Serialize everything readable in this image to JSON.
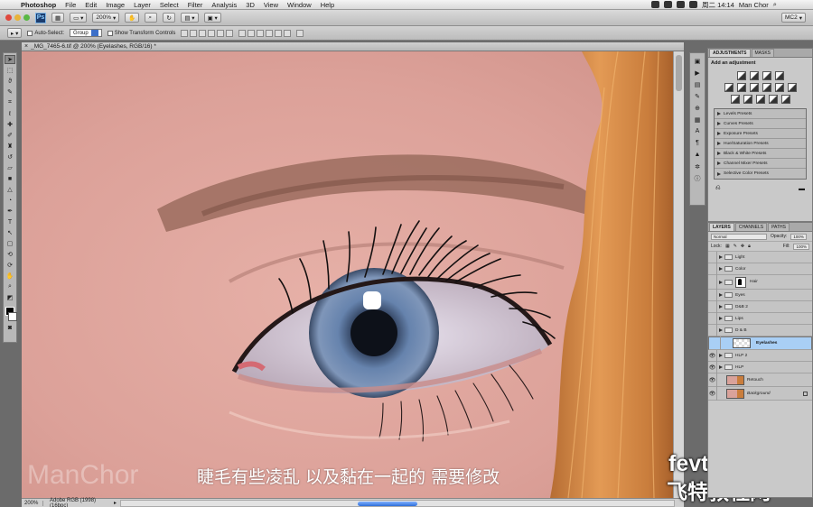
{
  "menubar": {
    "apple": "",
    "items": [
      "Photoshop",
      "File",
      "Edit",
      "Image",
      "Layer",
      "Select",
      "Filter",
      "Analysis",
      "3D",
      "View",
      "Window",
      "Help"
    ],
    "clock": "周二 14:14",
    "user": "Man Chor"
  },
  "appbar": {
    "ps_logo": "Ps",
    "zoom": "200%",
    "workspace": "MC2"
  },
  "options": {
    "auto_select_label": "Auto-Select:",
    "auto_select_value": "Group",
    "transform_label": "Show Transform Controls"
  },
  "document": {
    "tab_title": "_MG_7465-6.tif @ 200% (Eyelashes, RGB/16) *",
    "status_zoom": "200%",
    "status_info": "Adobe RGB (1998) (16bpc)"
  },
  "overlay": {
    "subtitle": "睫毛有些凌乱 以及黏在一起的 需要修改",
    "watermark_left": "ManChor",
    "watermark_right_1": "fevte.com",
    "watermark_right_2": "飞特教程网"
  },
  "adjustments": {
    "tabs": [
      "ADJUSTMENTS",
      "MASKS"
    ],
    "title": "Add an adjustment",
    "presets": [
      "Levels Presets",
      "Curves Presets",
      "Exposure Presets",
      "Hue/Saturation Presets",
      "Black & White Presets",
      "Channel Mixer Presets",
      "Selective Color Presets"
    ]
  },
  "layers_panel": {
    "tabs": [
      "LAYERS",
      "CHANNELS",
      "PATHS"
    ],
    "blend_mode": "Normal",
    "opacity_label": "Opacity:",
    "opacity_value": "100%",
    "lock_label": "Lock:",
    "fill_label": "Fill:",
    "fill_value": "100%",
    "layers": [
      {
        "name": "Light",
        "type": "group",
        "visible": false
      },
      {
        "name": "Color",
        "type": "group",
        "visible": false
      },
      {
        "name": "Hair",
        "type": "group-mask",
        "visible": false
      },
      {
        "name": "Eyes",
        "type": "group",
        "visible": false
      },
      {
        "name": "D&B 2",
        "type": "group",
        "visible": false
      },
      {
        "name": "Lips",
        "type": "group",
        "visible": false
      },
      {
        "name": "D & B",
        "type": "group",
        "visible": false
      },
      {
        "name": "Eyelashes",
        "type": "layer-empty",
        "visible": false,
        "selected": true
      },
      {
        "name": "HLP 2",
        "type": "group",
        "visible": true
      },
      {
        "name": "HLP",
        "type": "group",
        "visible": true
      },
      {
        "name": "Retouch",
        "type": "layer-image",
        "visible": true
      },
      {
        "name": "Background",
        "type": "layer-image",
        "visible": true,
        "locked": true
      }
    ]
  },
  "colors": {
    "skin": "#e0a79f",
    "hair": "#d98e4a",
    "iris": "#5f7faa",
    "selection": "#a9cff5"
  }
}
